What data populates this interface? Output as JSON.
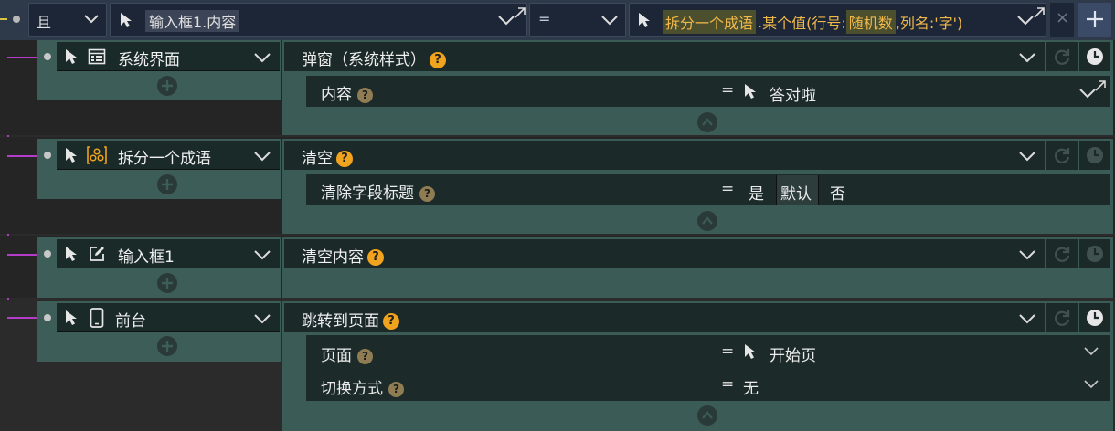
{
  "condition": {
    "logic": "且",
    "left_operand": "输入框1.内容",
    "operator": "=",
    "right_function": "拆分一个成语",
    "right_dot": ".",
    "right_method": "某个值",
    "right_args_open": "(行号:",
    "right_arg1": "随机数",
    "right_args_rest": ",列名:'字')"
  },
  "rows": [
    {
      "target": "系统界面",
      "action": "弹窗（系统样式）",
      "params": [
        {
          "label": "内容",
          "value": "答对啦"
        }
      ]
    },
    {
      "target": "拆分一个成语",
      "action": "清空",
      "params": [
        {
          "label": "清除字段标题",
          "options": [
            "是",
            "默认",
            "否"
          ],
          "selected": "默认"
        }
      ]
    },
    {
      "target": "输入框1",
      "action": "清空内容",
      "params": []
    },
    {
      "target": "前台",
      "action": "跳转到页面",
      "params": [
        {
          "label": "页面",
          "value": "开始页"
        },
        {
          "label": "切换方式",
          "value": "无"
        }
      ]
    }
  ],
  "symbols": {
    "equals": "=",
    "help": "?",
    "close": "×"
  },
  "colors": {
    "accent_orange": "#f0a31c",
    "tree_line": "#b43cc8",
    "panel": "#3b5b56"
  }
}
